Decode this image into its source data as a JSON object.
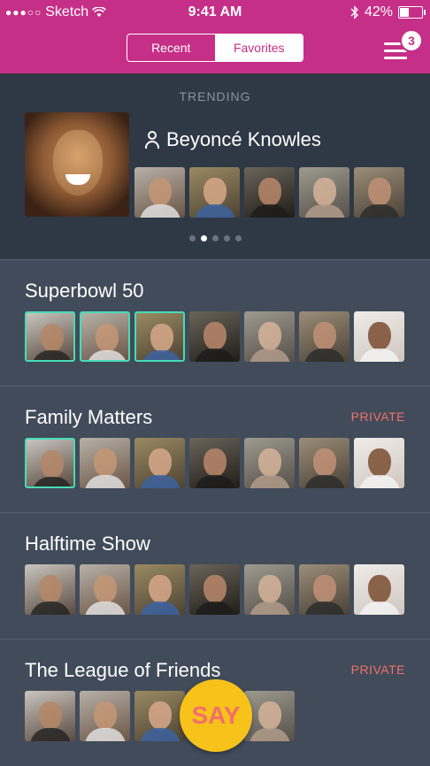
{
  "status_bar": {
    "signal": "●●●○○",
    "carrier": "Sketch",
    "time": "9:41 AM",
    "battery": "42%"
  },
  "header": {
    "segments": [
      "Recent",
      "Favorites"
    ],
    "selected_segment": "Favorites",
    "menu_badge": "3"
  },
  "trending": {
    "label": "TRENDING",
    "celebrity_name": "Beyoncé Knowles",
    "thumb_count": 5,
    "pager_active_index": 1,
    "pager_count": 5
  },
  "groups": [
    {
      "title": "Superbowl 50",
      "private": "",
      "selected": [
        true,
        true,
        true,
        false,
        false,
        false,
        false
      ]
    },
    {
      "title": "Family Matters",
      "private": "PRIVATE",
      "selected": [
        true,
        false,
        false,
        false,
        false,
        false,
        false
      ]
    },
    {
      "title": "Halftime Show",
      "private": "",
      "selected": [
        false,
        false,
        false,
        false,
        false,
        false,
        false
      ]
    },
    {
      "title": "The League of Friends",
      "private": "PRIVATE",
      "selected": [
        false,
        false,
        false,
        false,
        false,
        false,
        false
      ]
    }
  ],
  "say_button": {
    "label": "SAY"
  },
  "colors": {
    "header": "#c62f87",
    "trending_bg": "#2f3845",
    "list_bg": "#414b5a",
    "selection": "#47dcb5",
    "private": "#f2706b",
    "say": "#f7c21a"
  }
}
